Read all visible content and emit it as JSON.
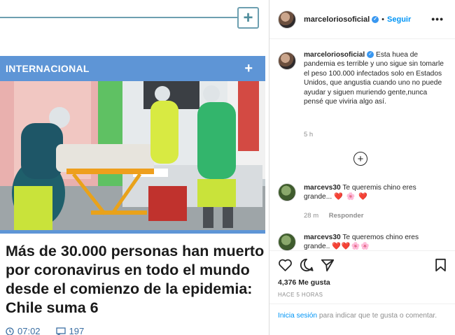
{
  "news": {
    "section_label": "INTERNACIONAL",
    "section_plus": "+",
    "header_plus": "+",
    "headline": "Más de 30.000 personas han muerto por coronavirus en todo el mundo desde el comienzo de la epidemia: Chile suma 6",
    "time": "07:02",
    "comments_count": "197",
    "accent_color": "#5e95d6"
  },
  "instagram": {
    "header": {
      "username": "marceloriosoficial",
      "separator": "•",
      "follow_label": "Seguir",
      "more_label": "•••"
    },
    "caption": {
      "username": "marceloriosoficial",
      "text": "Esta huea de pandemia es terrible y uno sigue sin tomarle el peso 100.000 infectados solo en Estados Unidos, que angustia cuando uno no puede ayudar y siguen muriendo gente,nunca pensé que viviria algo así.",
      "time": "5 h"
    },
    "load_more_label": "+",
    "comments": [
      {
        "username": "marcevs30",
        "text": "Te queremis chino eres grande...",
        "emoji": "❤️ 🌸 ❤️",
        "age": "28 m",
        "reply_label": "Responder"
      },
      {
        "username": "marcevs30",
        "text": "Te queremos chino eres grande..",
        "emoji": "❤️❤️🌸🌸"
      }
    ],
    "likes": "4,376 Me gusta",
    "posted": "HACE 5 HORAS",
    "login_link": "Inicia sesión",
    "login_text": " para indicar que te gusta o comentar.",
    "link_color": "#0095f6"
  }
}
